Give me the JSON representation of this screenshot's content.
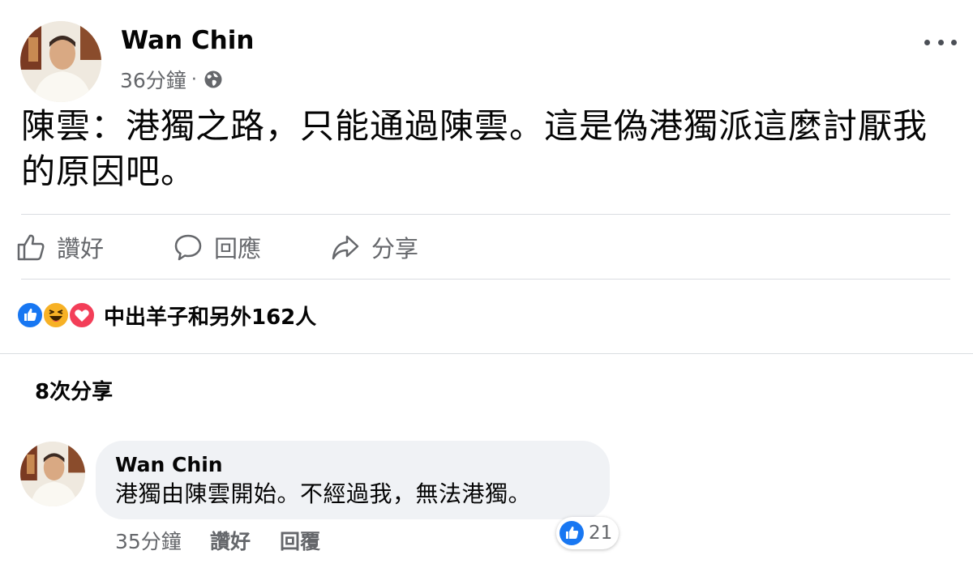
{
  "post": {
    "author_name": "Wan Chin",
    "timestamp": "36分鐘",
    "separator": "·",
    "privacy_icon": "globe-icon",
    "text": "陳雲：港獨之路，只能通過陳雲。這是偽港獨派這麼討厭我的原因吧。"
  },
  "actions": {
    "like_label": "讚好",
    "comment_label": "回應",
    "share_label": "分享"
  },
  "reactions": {
    "icons": [
      "like-icon",
      "haha-icon",
      "love-icon"
    ],
    "summary": "中出羊子和另外162人"
  },
  "shares": {
    "label": "8次分享"
  },
  "comment": {
    "author_name": "Wan Chin",
    "text": "港獨由陳雲開始。不經過我，無法港獨。",
    "timestamp": "35分鐘",
    "like_label": "讚好",
    "reply_label": "回覆",
    "like_count": "21"
  },
  "colors": {
    "like_blue": "#1877f2",
    "haha_yellow": "#f7b125",
    "love_red": "#f33e58",
    "muted_text": "#65676b",
    "bubble_bg": "#f0f2f5"
  }
}
